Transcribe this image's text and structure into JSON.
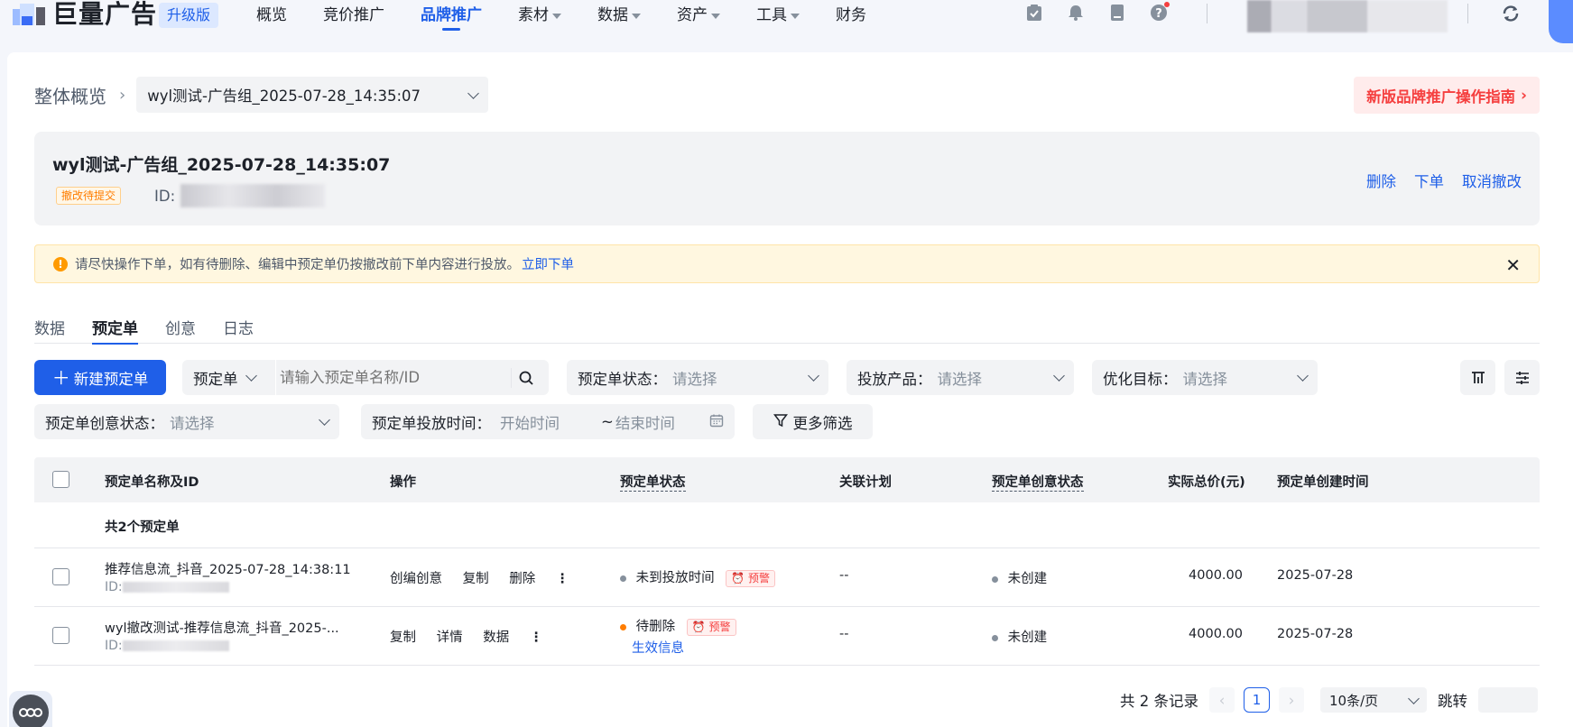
{
  "topnav": {
    "logo_text": "巨量广告",
    "upgrade_badge": "升级版",
    "items": [
      {
        "label": "概览",
        "dropdown": false,
        "active": false
      },
      {
        "label": "竞价推广",
        "dropdown": false,
        "active": false
      },
      {
        "label": "品牌推广",
        "dropdown": false,
        "active": true
      },
      {
        "label": "素材",
        "dropdown": true,
        "active": false
      },
      {
        "label": "数据",
        "dropdown": true,
        "active": false
      },
      {
        "label": "资产",
        "dropdown": true,
        "active": false
      },
      {
        "label": "工具",
        "dropdown": true,
        "active": false
      },
      {
        "label": "财务",
        "dropdown": false,
        "active": false
      }
    ],
    "icons": [
      "clipboard-check-icon",
      "bell-icon",
      "document-icon",
      "help-icon"
    ]
  },
  "breadcrumb": {
    "root": "整体概览",
    "current": "wyl测试-广告组_2025-07-28_14:35:07"
  },
  "guide_button": "新版品牌推广操作指南",
  "info_card": {
    "title": "wyl测试-广告组_2025-07-28_14:35:07",
    "status_tag": "撤改待提交",
    "id_label": "ID:",
    "actions": [
      "删除",
      "下单",
      "取消撤改"
    ]
  },
  "alert": {
    "text": "请尽快操作下单，如有待删除、编辑中预定单仍按撤改前下单内容进行投放。",
    "link": "立即下单"
  },
  "tabs": [
    "数据",
    "预定单",
    "创意",
    "日志"
  ],
  "active_tab": "预定单",
  "filters": {
    "new_button": "新建预定单",
    "search_type": "预定单",
    "search_placeholder": "请输入预定单名称/ID",
    "status_label": "预定单状态：",
    "status_placeholder": "请选择",
    "product_label": "投放产品：",
    "product_placeholder": "请选择",
    "goal_label": "优化目标：",
    "goal_placeholder": "请选择",
    "creative_status_label": "预定单创意状态：",
    "creative_status_placeholder": "请选择",
    "time_label": "预定单投放时间：",
    "start_placeholder": "开始时间",
    "end_placeholder": "结束时间",
    "time_sep": "~",
    "more_filters": "更多筛选"
  },
  "table": {
    "headers": {
      "name": "预定单名称及ID",
      "ops": "操作",
      "status": "预定单状态",
      "plan": "关联计划",
      "creative_status": "预定单创意状态",
      "price": "实际总价(元)",
      "created": "预定单创建时间"
    },
    "summary": "共2个预定单",
    "rows": [
      {
        "name": "推荐信息流_抖音_2025-07-28_14:38:11",
        "id_label": "ID:",
        "ops": [
          "创编创意",
          "复制",
          "删除"
        ],
        "status": "未到投放时间",
        "status_color": "#86909c",
        "warn_tag": "预警",
        "status_link": "",
        "plan": "--",
        "creative_status": "未创建",
        "price": "4000.00",
        "created": "2025-07-28"
      },
      {
        "name": "wyl撤改测试-推荐信息流_抖音_2025-...",
        "id_label": "ID:",
        "ops": [
          "复制",
          "详情",
          "数据"
        ],
        "status": "待删除",
        "status_color": "#ff7d00",
        "warn_tag": "预警",
        "status_link": "生效信息",
        "plan": "--",
        "creative_status": "未创建",
        "price": "4000.00",
        "created": "2025-07-28"
      }
    ]
  },
  "pagination": {
    "total_text": "共 2 条记录",
    "current_page": "1",
    "page_size": "10条/页",
    "jump_label": "跳转"
  },
  "colors": {
    "primary": "#1f5fe8",
    "danger": "#f53f3f",
    "warning": "#ff7d00"
  }
}
